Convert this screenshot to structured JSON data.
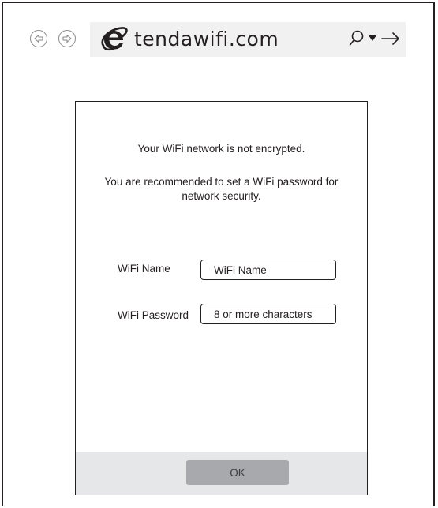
{
  "browser": {
    "back_icon": "back-arrow-icon",
    "forward_icon": "forward-arrow-icon",
    "browser_icon": "internet-explorer-icon",
    "address": "tendawifi.com",
    "search_icon": "search-icon",
    "dropdown_icon": "dropdown-triangle-icon",
    "go_icon": "go-arrow-icon"
  },
  "dialog": {
    "message_line1": "Your WiFi network is not encrypted.",
    "message_line2": "You are recommended to set a WiFi password for network security.",
    "wifi_name": {
      "label": "WiFi Name",
      "placeholder": "WiFi Name",
      "value": ""
    },
    "wifi_password": {
      "label": "WiFi Password",
      "placeholder": "8 or more characters",
      "value": ""
    },
    "ok_label": "OK"
  },
  "colors": {
    "outline": "#231f20",
    "address_bar": "#f1f1f2",
    "footer": "#e6e7e8",
    "ok_button": "#a7a9ac",
    "ie_icon": "#231f20"
  }
}
